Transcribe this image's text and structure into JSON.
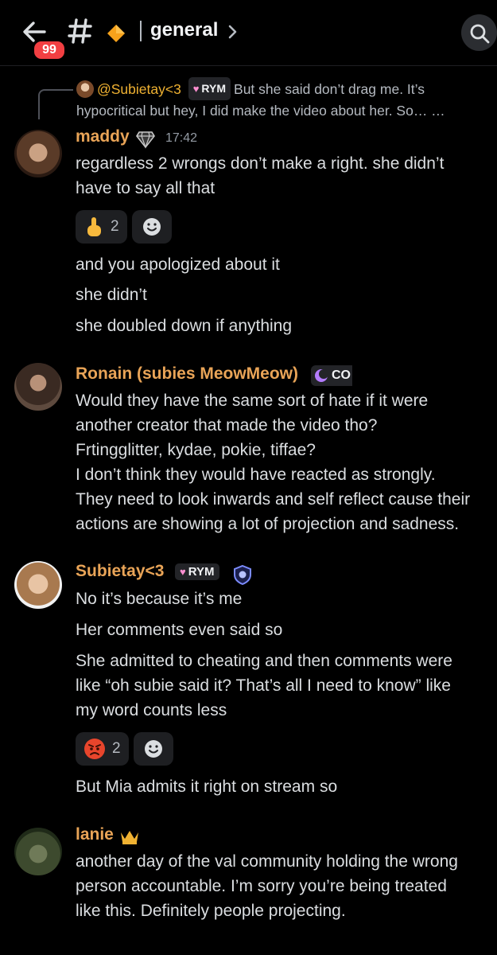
{
  "header": {
    "badge_count": "99",
    "channel_name": "general"
  },
  "reply": {
    "username": "@Subietay<3",
    "tag": "RYM",
    "text_line1": "But she said don’t drag me. It’s",
    "text_line2": "hypocritical but hey, I did make the video about her. So… …"
  },
  "messages": [
    {
      "username": "maddy",
      "time": "17:42",
      "lines": [
        "regardless 2 wrongs don’t make a right. she didn’t",
        "have to say all that"
      ],
      "reaction_count": "2",
      "followups": [
        "and you apologized about it",
        "she didn’t",
        "she doubled down if anything"
      ]
    },
    {
      "username": "Ronain (subies MeowMeow)",
      "tag": "CO",
      "lines": [
        "Would they have the same sort of hate if it were",
        "another creator that made the video tho?",
        "Frtingglitter, kydae, pokie, tiffae?",
        "I don’t think they would have reacted as strongly.",
        "They need to look inwards and self reflect cause their",
        "actions are showing a lot of projection and sadness."
      ]
    },
    {
      "username": "Subietay<3",
      "tag": "RYM",
      "lines": [
        "No it’s because it’s me"
      ],
      "followups": [
        "Her comments even said so",
        "She admitted to cheating and then comments were",
        "like “oh subie said it? That’s all I need to know” like",
        "my word counts less"
      ],
      "reaction_count": "2",
      "after": "But Mia admits it right on stream so"
    },
    {
      "username": "lanie",
      "lines": [
        "another day of the val community holding the wrong",
        "person accountable. I’m sorry you’re being treated",
        "like this. Definitely people projecting."
      ]
    }
  ],
  "icons": {
    "back": "back-arrow-icon",
    "hash": "hash-icon",
    "boost": "orange-diamond-icon",
    "chevron": "chevron-right-icon",
    "search": "search-icon",
    "point_emoji": "pointing-up-emoji",
    "angry_emoji": "angry-face-emoji",
    "add_reaction": "add-reaction-icon"
  },
  "colors": {
    "background": "#000000",
    "username": "#e9a457",
    "badge": "#f23f42",
    "text": "#dbdee1"
  }
}
